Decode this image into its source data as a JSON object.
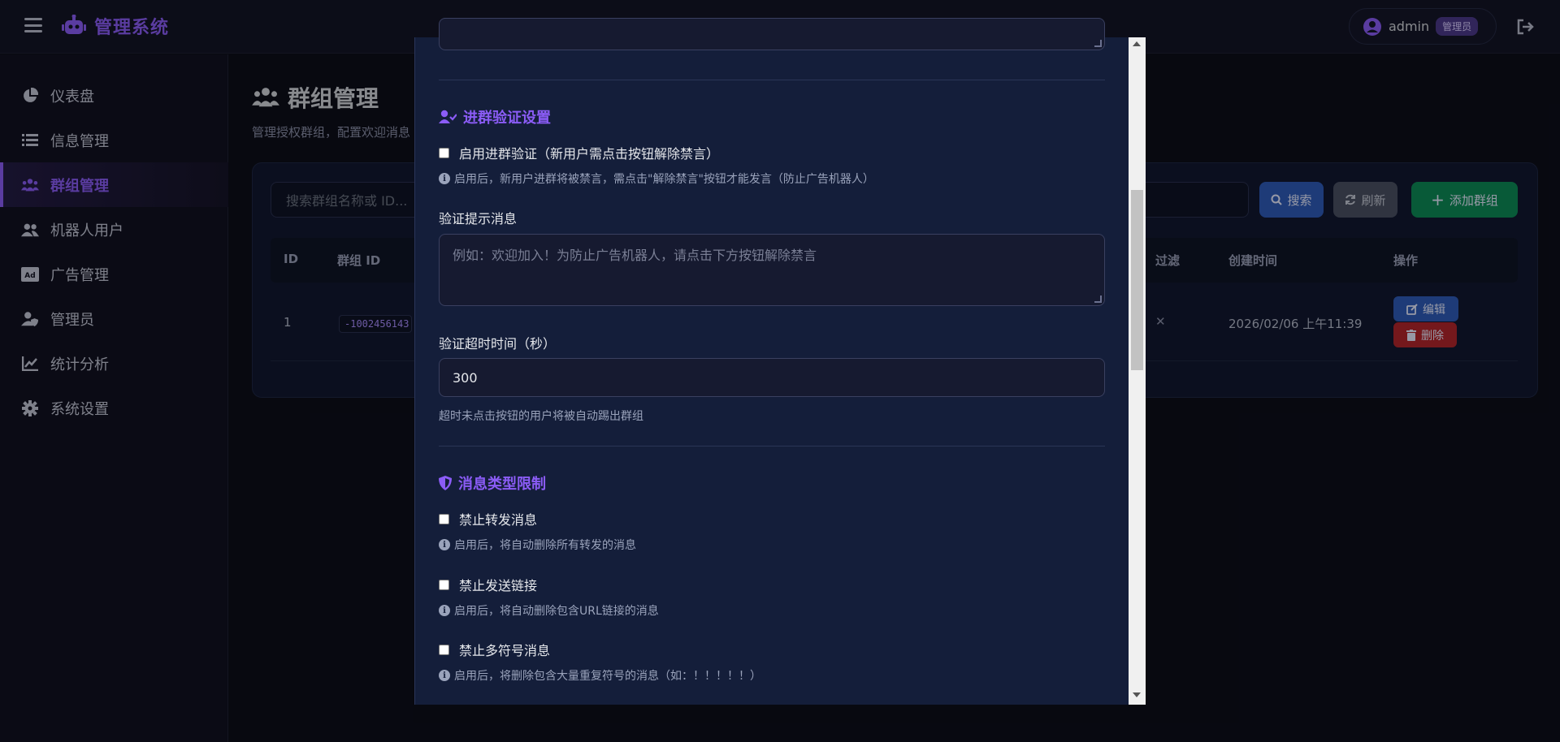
{
  "header": {
    "brand": "管理系统",
    "user": "admin",
    "role": "管理员"
  },
  "sidebar": {
    "items": [
      {
        "label": "仪表盘",
        "icon": "pie-chart-icon"
      },
      {
        "label": "信息管理",
        "icon": "list-icon"
      },
      {
        "label": "群组管理",
        "icon": "users-group-icon",
        "active": true
      },
      {
        "label": "机器人用户",
        "icon": "users-icon"
      },
      {
        "label": "广告管理",
        "icon": "ad-icon"
      },
      {
        "label": "管理员",
        "icon": "user-shield-icon"
      },
      {
        "label": "统计分析",
        "icon": "line-chart-icon"
      },
      {
        "label": "系统设置",
        "icon": "gear-icon"
      }
    ]
  },
  "page": {
    "title": "群组管理",
    "subtitle": "管理授权群组，配置欢迎消息"
  },
  "toolbar": {
    "search_placeholder": "搜索群组名称或 ID...",
    "search_label": "搜索",
    "refresh_label": "刷新",
    "add_label": "添加群组"
  },
  "table": {
    "headers": {
      "id": "ID",
      "group_id": "群组 ID",
      "filter": "过滤",
      "created": "创建时间",
      "actions": "操作"
    },
    "rows": [
      {
        "id": "1",
        "group_id": "-1002456143",
        "filter": "✕",
        "created": "2026/02/06 上午11:39",
        "edit": "编辑",
        "delete": "删除"
      }
    ]
  },
  "modal": {
    "verify_section_title": "进群验证设置",
    "verify_enable_label": "启用进群验证（新用户需点击按钮解除禁言）",
    "verify_enable_hint": "启用后，新用户进群将被禁言，需点击\"解除禁言\"按钮才能发言（防止广告机器人）",
    "verify_message_label": "验证提示消息",
    "verify_message_placeholder": "例如：欢迎加入！为防止广告机器人，请点击下方按钮解除禁言",
    "verify_timeout_label": "验证超时时间（秒）",
    "verify_timeout_value": "300",
    "verify_timeout_help": "超时未点击按钮的用户将被自动踢出群组",
    "msg_section_title": "消息类型限制",
    "forward_label": "禁止转发消息",
    "forward_hint": "启用后，将自动删除所有转发的消息",
    "link_label": "禁止发送链接",
    "link_hint": "启用后，将自动删除包含URL链接的消息",
    "symbol_label": "禁止多符号消息",
    "symbol_hint": "启用后，将删除包含大量重复符号的消息（如：！！！！！）"
  }
}
